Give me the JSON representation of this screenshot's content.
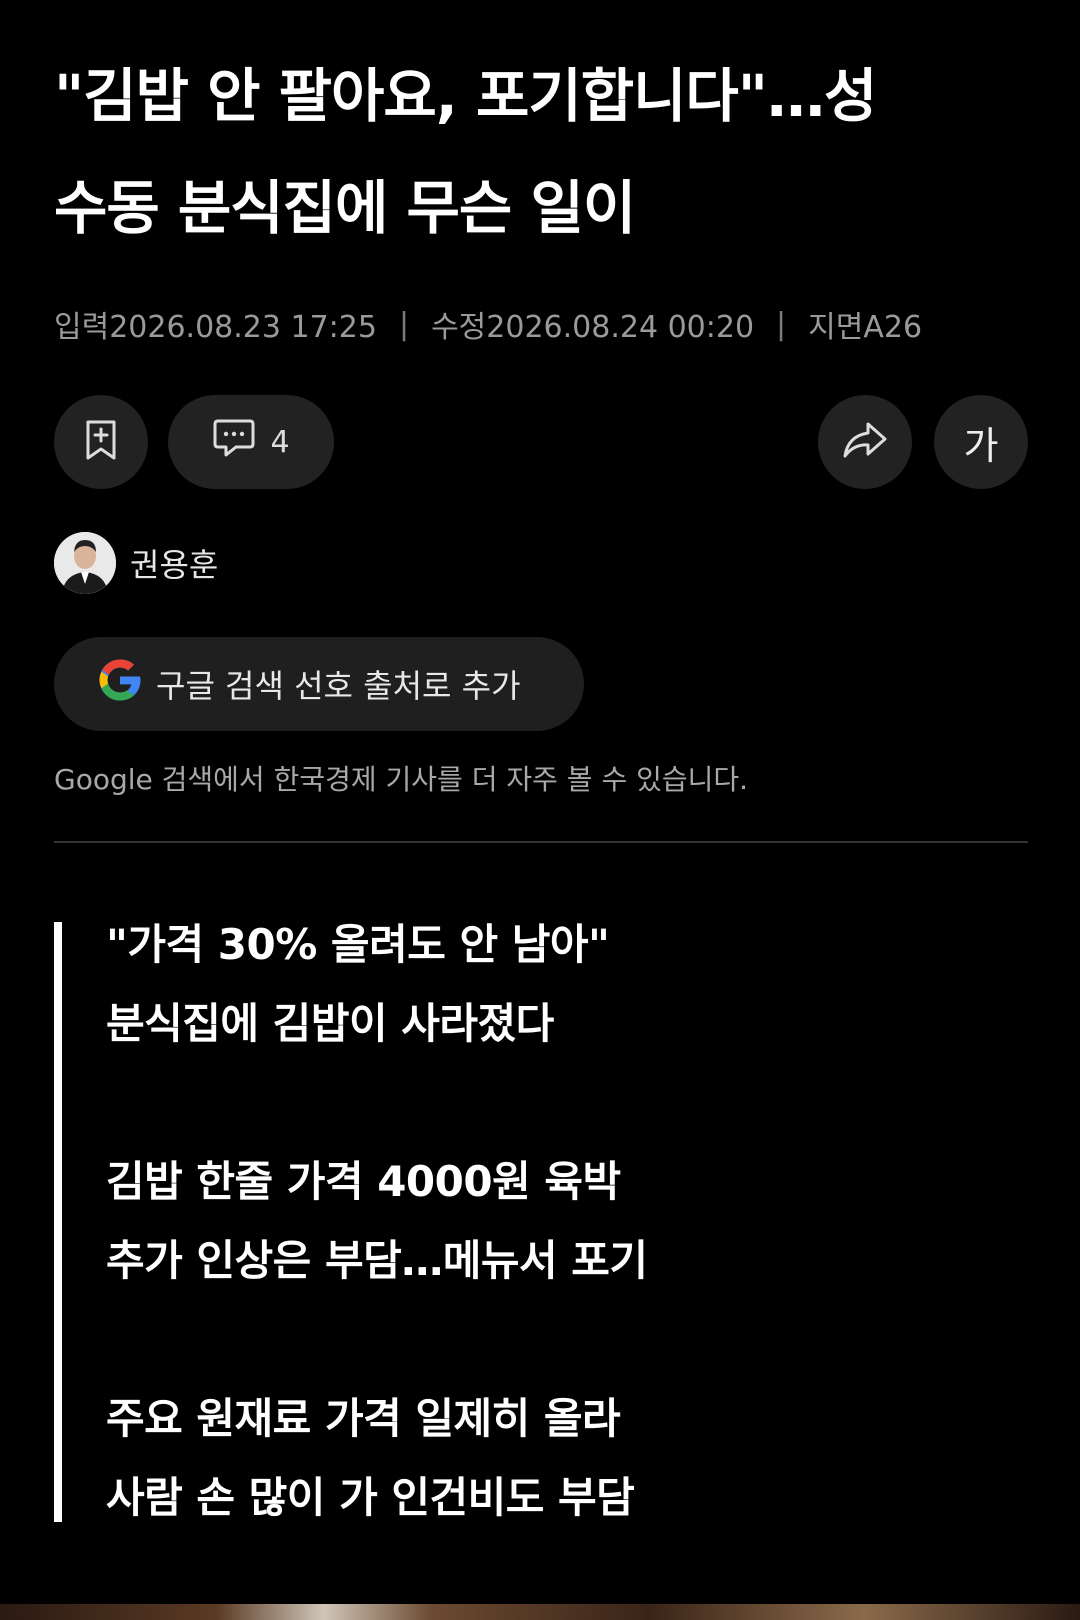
{
  "article": {
    "title_line1": "\"김밥 안 팔아요, 포기합니다\"…성",
    "title_line2": "수동 분식집에 무슨 일이",
    "meta": {
      "input": "입력2026.08.23 17:25",
      "modified": "수정2026.08.24 00:20",
      "page": "지면A26"
    }
  },
  "toolbar": {
    "bookmark_icon": "bookmark-add-icon",
    "comment_icon": "comment-icon",
    "comment_count": "4",
    "share_icon": "share-icon",
    "font_size_label": "가"
  },
  "author": {
    "name": "권용훈"
  },
  "google": {
    "button_label": "구글 검색 선호 출처로 추가",
    "note": "Google 검색에서 한국경제 기사를 더 자주 볼 수 있습니다."
  },
  "summary": {
    "groups": [
      [
        "\"가격 30% 올려도 안 남아\"",
        "분식집에 김밥이 사라졌다"
      ],
      [
        "김밥 한줄 가격 4000원 육박",
        "추가 인상은 부담…메뉴서 포기"
      ],
      [
        "주요 원재료 가격 일제히 올라",
        "사람 손 많이 가 인건비도 부담"
      ]
    ]
  }
}
